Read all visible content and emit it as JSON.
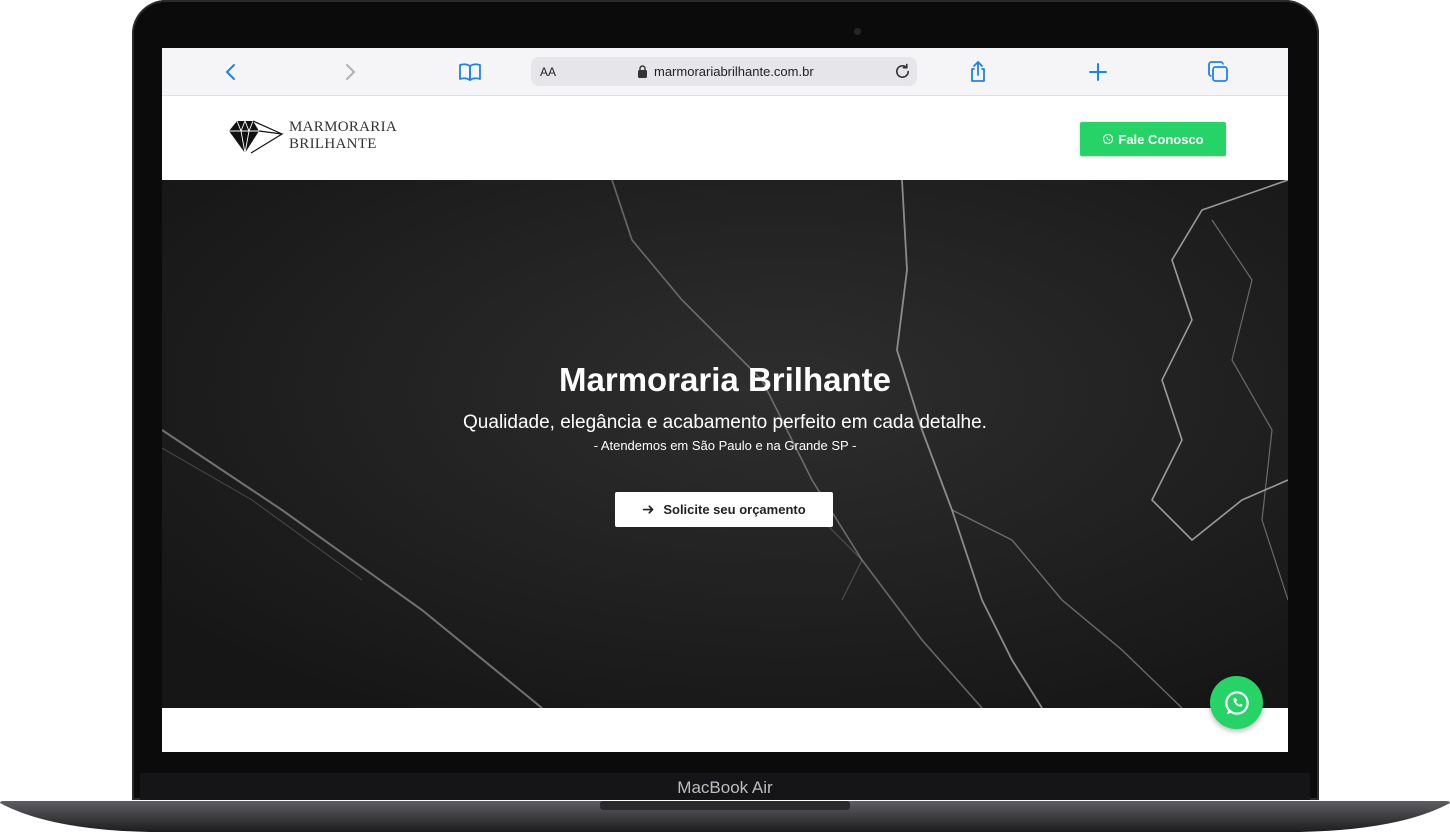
{
  "device": {
    "label": "MacBook Air"
  },
  "browser": {
    "text_size_label": "AA",
    "url": "marmorariabrilhante.com.br",
    "icons": [
      "chevron-left-icon",
      "chevron-right-icon",
      "book-icon",
      "lock-icon",
      "reload-icon",
      "share-icon",
      "plus-icon",
      "tabs-icon"
    ],
    "accent": "#1a82f7"
  },
  "site": {
    "logo": {
      "line1": "MARMORARIA",
      "line2": "BRILHANTE"
    },
    "header_button": {
      "label": "Fale Conosco",
      "color": "#25d366"
    },
    "hero": {
      "title": "Marmoraria Brilhante",
      "subtitle": "Qualidade, elegância e acabamento perfeito em cada detalhe.",
      "note": "- Atendemos em São Paulo e na Grande SP -",
      "cta_label": "Solicite seu orçamento"
    },
    "floating_whatsapp_icon": "whatsapp-icon"
  }
}
